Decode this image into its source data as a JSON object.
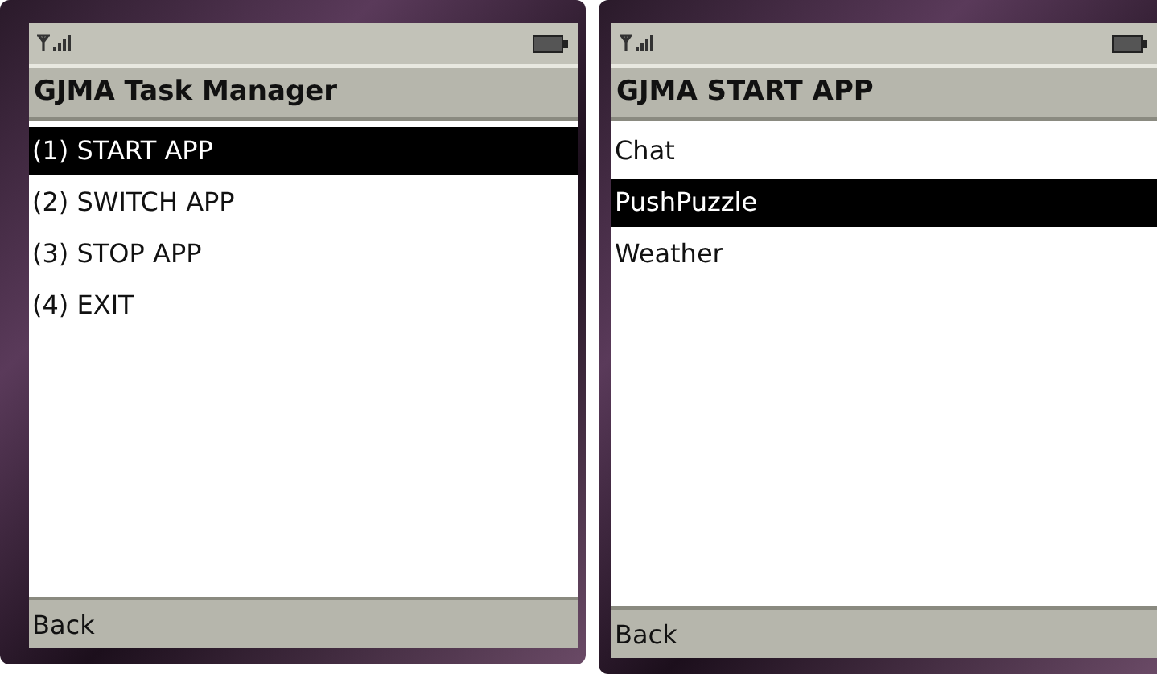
{
  "screens": [
    {
      "title": "GJMA Task Manager",
      "items": [
        {
          "label": "(1) START APP",
          "selected": true
        },
        {
          "label": "(2) SWITCH APP",
          "selected": false
        },
        {
          "label": "(3) STOP APP",
          "selected": false
        },
        {
          "label": "(4) EXIT",
          "selected": false
        }
      ],
      "softkey": "Back"
    },
    {
      "title": "GJMA START APP",
      "items": [
        {
          "label": "Chat",
          "selected": false
        },
        {
          "label": "PushPuzzle",
          "selected": true
        },
        {
          "label": "Weather",
          "selected": false
        }
      ],
      "softkey": "Back"
    }
  ]
}
